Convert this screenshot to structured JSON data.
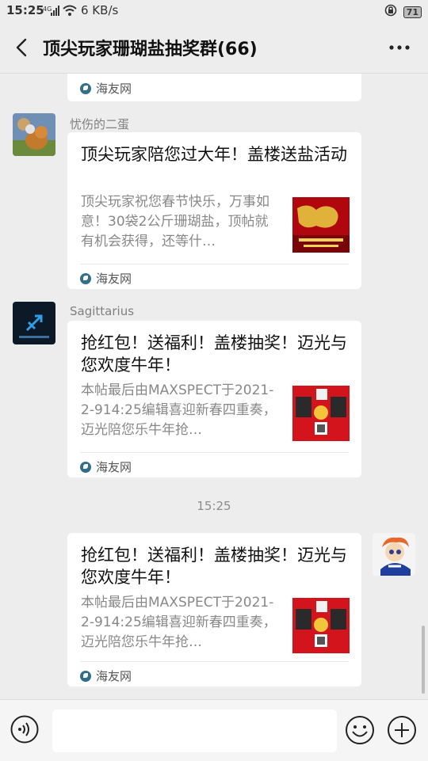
{
  "status": {
    "time": "15:25",
    "signal": "4G",
    "speed": "6 KB/s",
    "battery": "71"
  },
  "header": {
    "title": "顶尖玩家珊瑚盐抽奖群(66)"
  },
  "messages": [
    {
      "source": "海友网"
    },
    {
      "sender": "忧伤的二蛋",
      "title": "顶尖玩家陪您过大年！盖楼送盐活动",
      "desc": "顶尖玩家祝您春节快乐，万事如意！30袋2公斤珊瑚盐，顶帖就有机会获得，还等什…",
      "source": "海友网"
    },
    {
      "sender": "Sagittarius",
      "title": "抢红包！送福利！盖楼抽奖！迈光与您欢度牛年！",
      "desc": "本帖最后由MAXSPECT于2021-2-914:25编辑喜迎新春四重奏，迈光陪您乐牛年抢…",
      "source": "海友网"
    },
    {
      "time": "15:25"
    },
    {
      "title": "抢红包！送福利！盖楼抽奖！迈光与您欢度牛年！",
      "desc": "本帖最后由MAXSPECT于2021-2-914:25编辑喜迎新春四重奏，迈光陪您乐牛年抢…",
      "source": "海友网"
    }
  ],
  "colors": {
    "background": "#ededed",
    "card": "#ffffff",
    "thumb_red": "#c8121a"
  }
}
